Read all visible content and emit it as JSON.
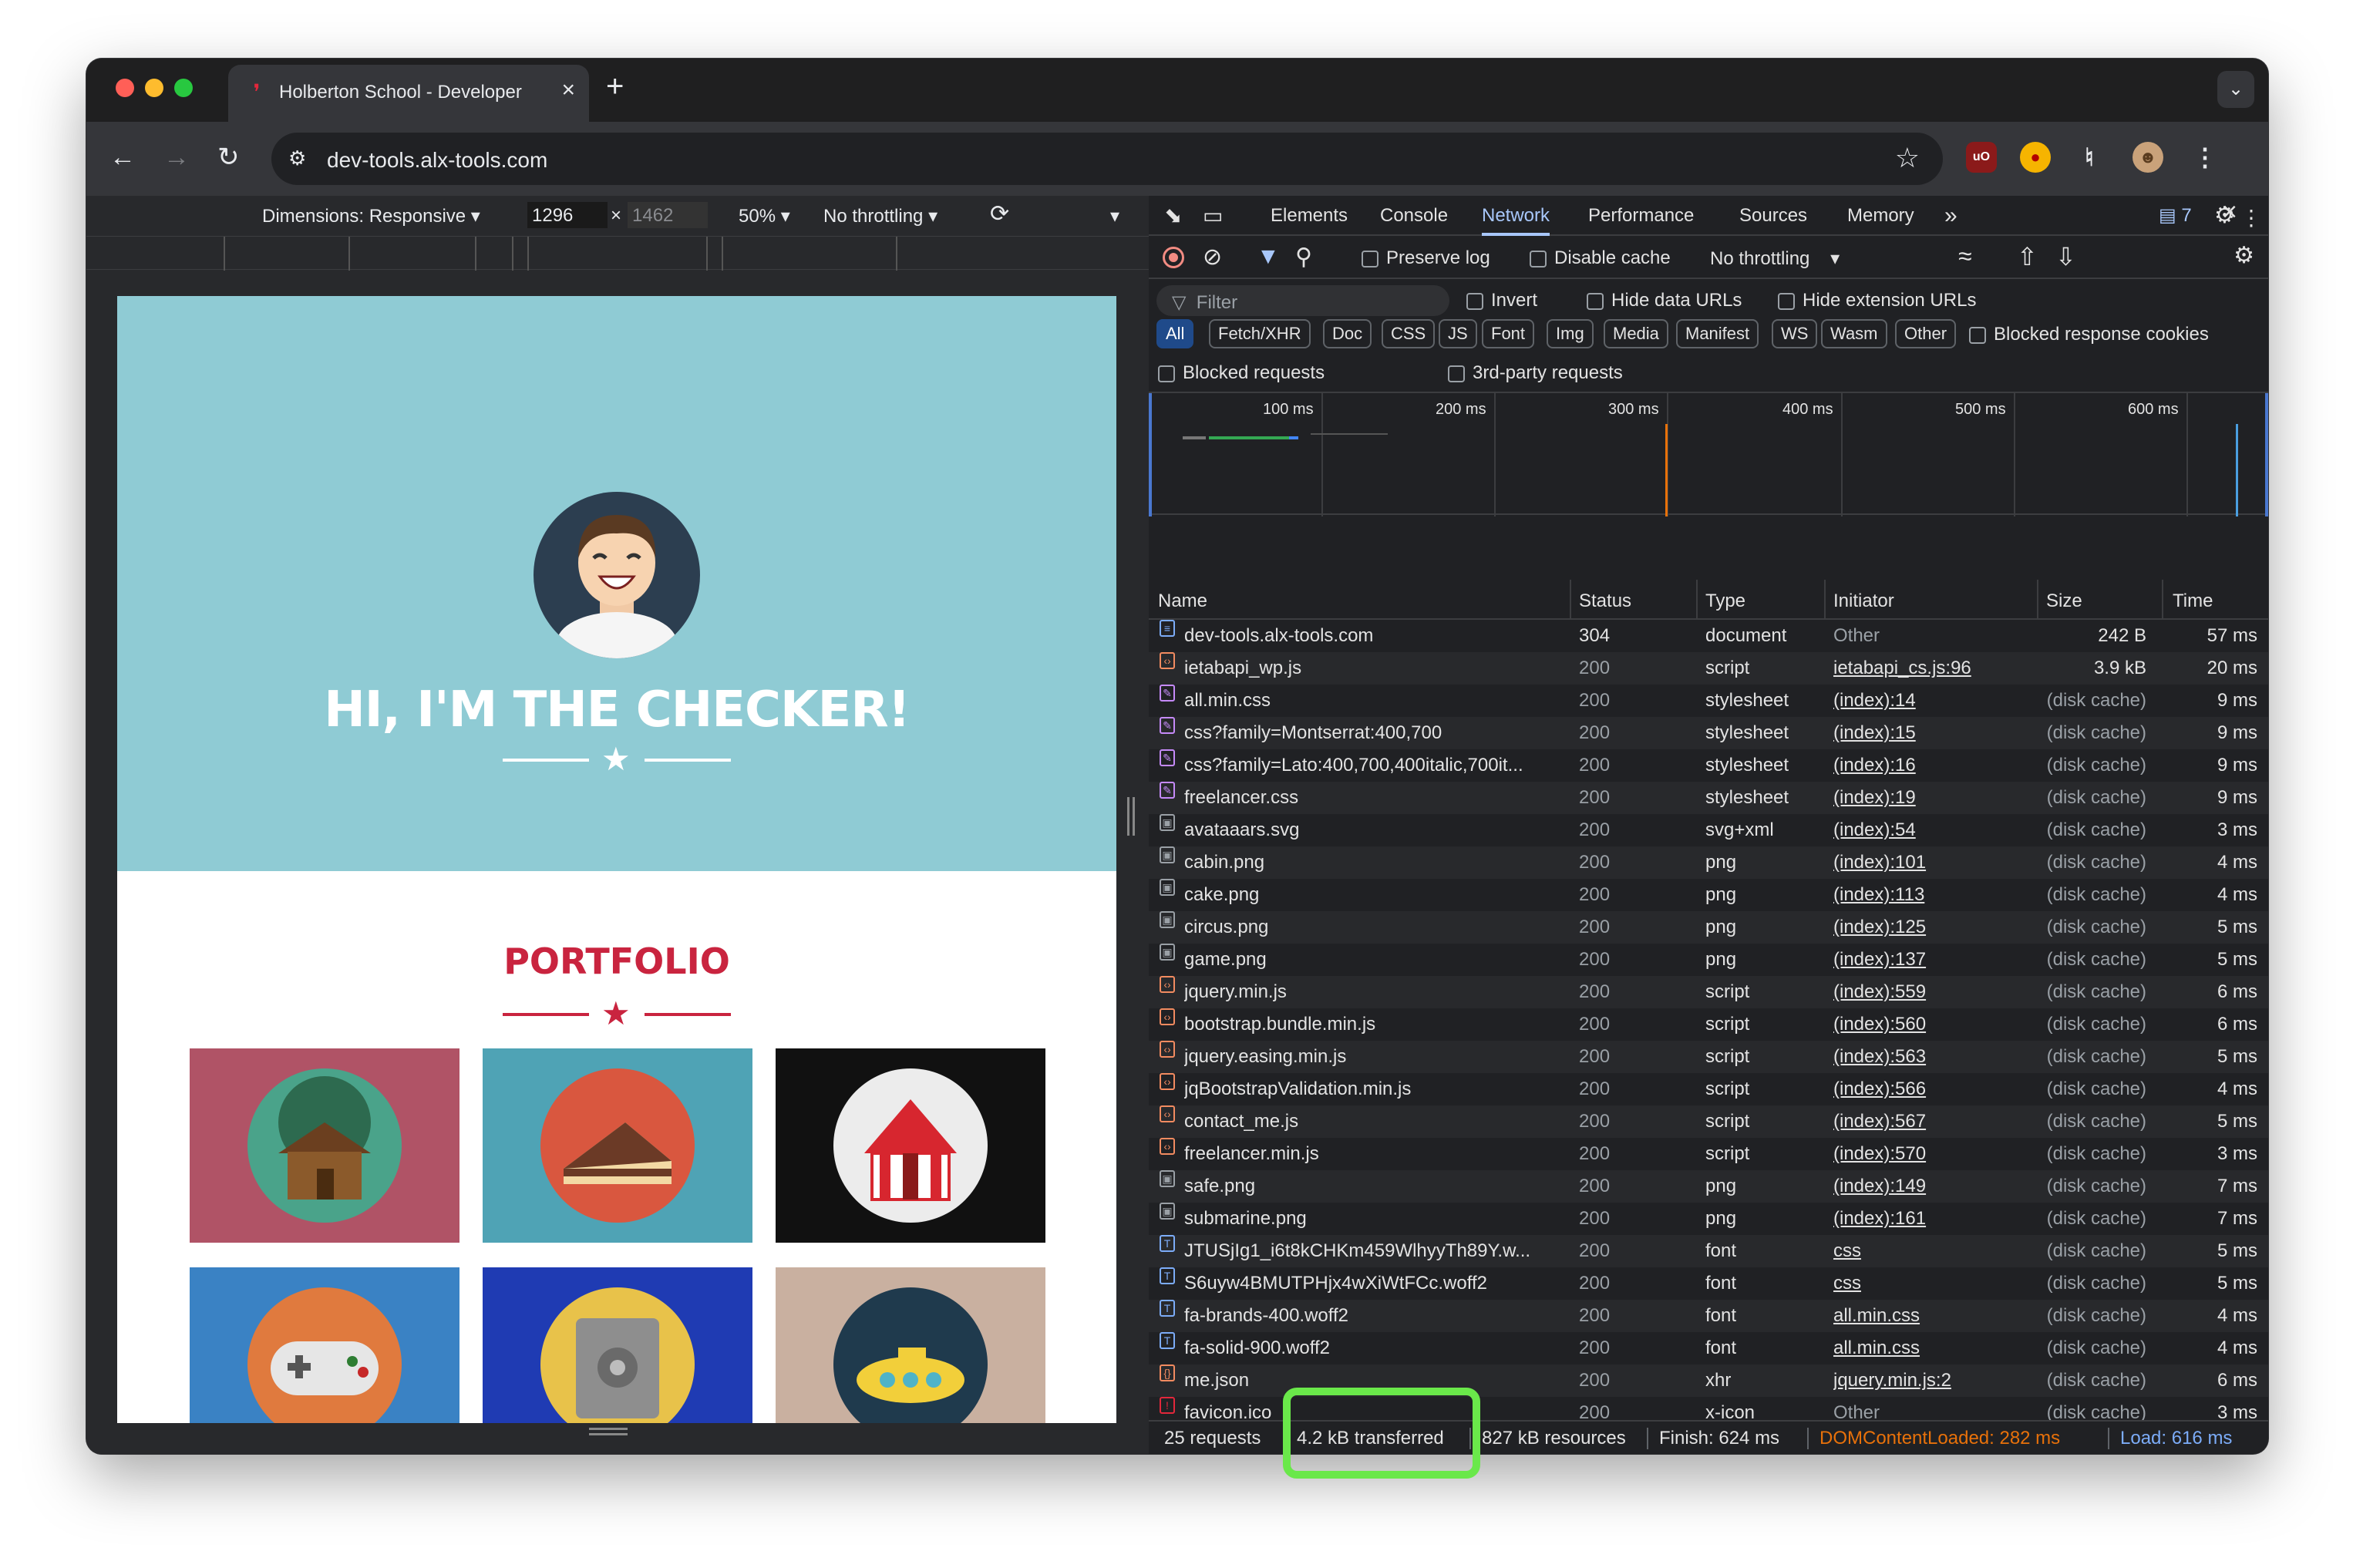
{
  "browser": {
    "tab_title": "Holberton School - Developer",
    "tab_close": "×",
    "new_tab": "+",
    "url": "dev-tools.alx-tools.com"
  },
  "device_toolbar": {
    "dimensions_label": "Dimensions: Responsive",
    "width": "1296",
    "height": "1462",
    "times": "×",
    "zoom": "50%",
    "throttling": "No throttling"
  },
  "page": {
    "hero_title": "HI, I'M THE CHECKER!",
    "portfolio_title": "PORTFOLIO",
    "colors": {
      "hero_bg": "#8fcbd4",
      "accent": "#c9243f"
    }
  },
  "devtools": {
    "tabs": [
      "Elements",
      "Console",
      "Network",
      "Performance",
      "Sources",
      "Memory"
    ],
    "active_tab": "Network",
    "more_tabs": "»",
    "issues_count": "7",
    "toolbar": {
      "preserve_log": "Preserve log",
      "disable_cache": "Disable cache",
      "throttling": "No throttling"
    },
    "filter": {
      "placeholder": "Filter",
      "invert": "Invert",
      "hide_data_urls": "Hide data URLs",
      "hide_extension_urls": "Hide extension URLs"
    },
    "type_filters": [
      "All",
      "Fetch/XHR",
      "Doc",
      "CSS",
      "JS",
      "Font",
      "Img",
      "Media",
      "Manifest",
      "WS",
      "Wasm",
      "Other"
    ],
    "blocked_response_cookies": "Blocked response cookies",
    "blocked_requests": "Blocked requests",
    "third_party_requests": "3rd-party requests",
    "timeline_ticks": [
      "100 ms",
      "200 ms",
      "300 ms",
      "400 ms",
      "500 ms",
      "600 ms"
    ],
    "columns": [
      "Name",
      "Status",
      "Type",
      "Initiator",
      "Size",
      "Time"
    ],
    "requests": [
      {
        "name": "dev-tools.alx-tools.com",
        "status": "304",
        "type": "document",
        "initiator": "Other",
        "size": "242 B",
        "time": "57 ms",
        "icon": "doc"
      },
      {
        "name": "ietabapi_wp.js",
        "status": "200",
        "type": "script",
        "initiator": "ietabapi_cs.js:96",
        "size": "3.9 kB",
        "time": "20 ms",
        "icon": "script"
      },
      {
        "name": "all.min.css",
        "status": "200",
        "type": "stylesheet",
        "initiator": "(index):14",
        "size": "(disk cache)",
        "time": "9 ms",
        "icon": "css"
      },
      {
        "name": "css?family=Montserrat:400,700",
        "status": "200",
        "type": "stylesheet",
        "initiator": "(index):15",
        "size": "(disk cache)",
        "time": "9 ms",
        "icon": "css"
      },
      {
        "name": "css?family=Lato:400,700,400italic,700it...",
        "status": "200",
        "type": "stylesheet",
        "initiator": "(index):16",
        "size": "(disk cache)",
        "time": "9 ms",
        "icon": "css"
      },
      {
        "name": "freelancer.css",
        "status": "200",
        "type": "stylesheet",
        "initiator": "(index):19",
        "size": "(disk cache)",
        "time": "9 ms",
        "icon": "css"
      },
      {
        "name": "avataaars.svg",
        "status": "200",
        "type": "svg+xml",
        "initiator": "(index):54",
        "size": "(disk cache)",
        "time": "3 ms",
        "icon": "img"
      },
      {
        "name": "cabin.png",
        "status": "200",
        "type": "png",
        "initiator": "(index):101",
        "size": "(disk cache)",
        "time": "4 ms",
        "icon": "img"
      },
      {
        "name": "cake.png",
        "status": "200",
        "type": "png",
        "initiator": "(index):113",
        "size": "(disk cache)",
        "time": "4 ms",
        "icon": "img"
      },
      {
        "name": "circus.png",
        "status": "200",
        "type": "png",
        "initiator": "(index):125",
        "size": "(disk cache)",
        "time": "5 ms",
        "icon": "img"
      },
      {
        "name": "game.png",
        "status": "200",
        "type": "png",
        "initiator": "(index):137",
        "size": "(disk cache)",
        "time": "5 ms",
        "icon": "img"
      },
      {
        "name": "jquery.min.js",
        "status": "200",
        "type": "script",
        "initiator": "(index):559",
        "size": "(disk cache)",
        "time": "6 ms",
        "icon": "script"
      },
      {
        "name": "bootstrap.bundle.min.js",
        "status": "200",
        "type": "script",
        "initiator": "(index):560",
        "size": "(disk cache)",
        "time": "6 ms",
        "icon": "script"
      },
      {
        "name": "jquery.easing.min.js",
        "status": "200",
        "type": "script",
        "initiator": "(index):563",
        "size": "(disk cache)",
        "time": "5 ms",
        "icon": "script"
      },
      {
        "name": "jqBootstrapValidation.min.js",
        "status": "200",
        "type": "script",
        "initiator": "(index):566",
        "size": "(disk cache)",
        "time": "4 ms",
        "icon": "script"
      },
      {
        "name": "contact_me.js",
        "status": "200",
        "type": "script",
        "initiator": "(index):567",
        "size": "(disk cache)",
        "time": "5 ms",
        "icon": "script"
      },
      {
        "name": "freelancer.min.js",
        "status": "200",
        "type": "script",
        "initiator": "(index):570",
        "size": "(disk cache)",
        "time": "3 ms",
        "icon": "script"
      },
      {
        "name": "safe.png",
        "status": "200",
        "type": "png",
        "initiator": "(index):149",
        "size": "(disk cache)",
        "time": "7 ms",
        "icon": "img"
      },
      {
        "name": "submarine.png",
        "status": "200",
        "type": "png",
        "initiator": "(index):161",
        "size": "(disk cache)",
        "time": "7 ms",
        "icon": "img"
      },
      {
        "name": "JTUSjIg1_i6t8kCHKm459WlhyyTh89Y.w...",
        "status": "200",
        "type": "font",
        "initiator": "css",
        "size": "(disk cache)",
        "time": "5 ms",
        "icon": "font"
      },
      {
        "name": "S6uyw4BMUTPHjx4wXiWtFCc.woff2",
        "status": "200",
        "type": "font",
        "initiator": "css",
        "size": "(disk cache)",
        "time": "5 ms",
        "icon": "font"
      },
      {
        "name": "fa-brands-400.woff2",
        "status": "200",
        "type": "font",
        "initiator": "all.min.css",
        "size": "(disk cache)",
        "time": "4 ms",
        "icon": "font"
      },
      {
        "name": "fa-solid-900.woff2",
        "status": "200",
        "type": "font",
        "initiator": "all.min.css",
        "size": "(disk cache)",
        "time": "4 ms",
        "icon": "font"
      },
      {
        "name": "me.json",
        "status": "200",
        "type": "xhr",
        "initiator": "jquery.min.js:2",
        "size": "(disk cache)",
        "time": "6 ms",
        "icon": "xhr"
      },
      {
        "name": "favicon.ico",
        "status": "200",
        "type": "x-icon",
        "initiator": "Other",
        "size": "(disk cache)",
        "time": "3 ms",
        "icon": "favicon"
      }
    ],
    "summary": {
      "requests": "25 requests",
      "transferred": "4.2 kB transferred",
      "resources": "827 kB resources",
      "finish": "Finish: 624 ms",
      "dom_content_loaded": "DOMContentLoaded: 282 ms",
      "load": "Load: 616 ms"
    }
  }
}
